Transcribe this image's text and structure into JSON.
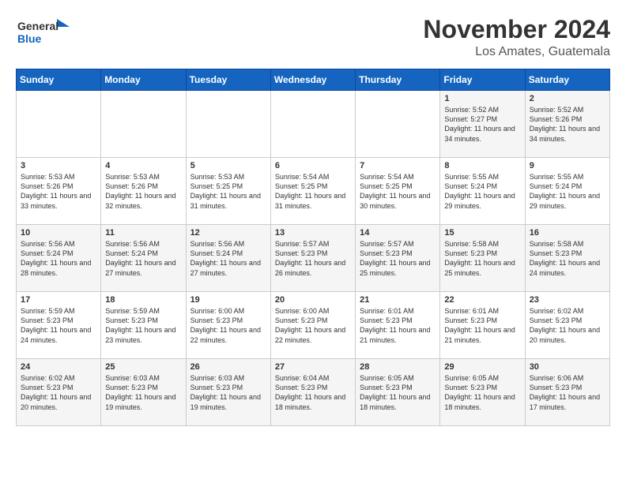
{
  "header": {
    "logo_general": "General",
    "logo_blue": "Blue",
    "month_title": "November 2024",
    "location": "Los Amates, Guatemala"
  },
  "days_of_week": [
    "Sunday",
    "Monday",
    "Tuesday",
    "Wednesday",
    "Thursday",
    "Friday",
    "Saturday"
  ],
  "weeks": [
    [
      {
        "day": "",
        "info": ""
      },
      {
        "day": "",
        "info": ""
      },
      {
        "day": "",
        "info": ""
      },
      {
        "day": "",
        "info": ""
      },
      {
        "day": "",
        "info": ""
      },
      {
        "day": "1",
        "info": "Sunrise: 5:52 AM\nSunset: 5:27 PM\nDaylight: 11 hours and 34 minutes."
      },
      {
        "day": "2",
        "info": "Sunrise: 5:52 AM\nSunset: 5:26 PM\nDaylight: 11 hours and 34 minutes."
      }
    ],
    [
      {
        "day": "3",
        "info": "Sunrise: 5:53 AM\nSunset: 5:26 PM\nDaylight: 11 hours and 33 minutes."
      },
      {
        "day": "4",
        "info": "Sunrise: 5:53 AM\nSunset: 5:26 PM\nDaylight: 11 hours and 32 minutes."
      },
      {
        "day": "5",
        "info": "Sunrise: 5:53 AM\nSunset: 5:25 PM\nDaylight: 11 hours and 31 minutes."
      },
      {
        "day": "6",
        "info": "Sunrise: 5:54 AM\nSunset: 5:25 PM\nDaylight: 11 hours and 31 minutes."
      },
      {
        "day": "7",
        "info": "Sunrise: 5:54 AM\nSunset: 5:25 PM\nDaylight: 11 hours and 30 minutes."
      },
      {
        "day": "8",
        "info": "Sunrise: 5:55 AM\nSunset: 5:24 PM\nDaylight: 11 hours and 29 minutes."
      },
      {
        "day": "9",
        "info": "Sunrise: 5:55 AM\nSunset: 5:24 PM\nDaylight: 11 hours and 29 minutes."
      }
    ],
    [
      {
        "day": "10",
        "info": "Sunrise: 5:56 AM\nSunset: 5:24 PM\nDaylight: 11 hours and 28 minutes."
      },
      {
        "day": "11",
        "info": "Sunrise: 5:56 AM\nSunset: 5:24 PM\nDaylight: 11 hours and 27 minutes."
      },
      {
        "day": "12",
        "info": "Sunrise: 5:56 AM\nSunset: 5:24 PM\nDaylight: 11 hours and 27 minutes."
      },
      {
        "day": "13",
        "info": "Sunrise: 5:57 AM\nSunset: 5:23 PM\nDaylight: 11 hours and 26 minutes."
      },
      {
        "day": "14",
        "info": "Sunrise: 5:57 AM\nSunset: 5:23 PM\nDaylight: 11 hours and 25 minutes."
      },
      {
        "day": "15",
        "info": "Sunrise: 5:58 AM\nSunset: 5:23 PM\nDaylight: 11 hours and 25 minutes."
      },
      {
        "day": "16",
        "info": "Sunrise: 5:58 AM\nSunset: 5:23 PM\nDaylight: 11 hours and 24 minutes."
      }
    ],
    [
      {
        "day": "17",
        "info": "Sunrise: 5:59 AM\nSunset: 5:23 PM\nDaylight: 11 hours and 24 minutes."
      },
      {
        "day": "18",
        "info": "Sunrise: 5:59 AM\nSunset: 5:23 PM\nDaylight: 11 hours and 23 minutes."
      },
      {
        "day": "19",
        "info": "Sunrise: 6:00 AM\nSunset: 5:23 PM\nDaylight: 11 hours and 22 minutes."
      },
      {
        "day": "20",
        "info": "Sunrise: 6:00 AM\nSunset: 5:23 PM\nDaylight: 11 hours and 22 minutes."
      },
      {
        "day": "21",
        "info": "Sunrise: 6:01 AM\nSunset: 5:23 PM\nDaylight: 11 hours and 21 minutes."
      },
      {
        "day": "22",
        "info": "Sunrise: 6:01 AM\nSunset: 5:23 PM\nDaylight: 11 hours and 21 minutes."
      },
      {
        "day": "23",
        "info": "Sunrise: 6:02 AM\nSunset: 5:23 PM\nDaylight: 11 hours and 20 minutes."
      }
    ],
    [
      {
        "day": "24",
        "info": "Sunrise: 6:02 AM\nSunset: 5:23 PM\nDaylight: 11 hours and 20 minutes."
      },
      {
        "day": "25",
        "info": "Sunrise: 6:03 AM\nSunset: 5:23 PM\nDaylight: 11 hours and 19 minutes."
      },
      {
        "day": "26",
        "info": "Sunrise: 6:03 AM\nSunset: 5:23 PM\nDaylight: 11 hours and 19 minutes."
      },
      {
        "day": "27",
        "info": "Sunrise: 6:04 AM\nSunset: 5:23 PM\nDaylight: 11 hours and 18 minutes."
      },
      {
        "day": "28",
        "info": "Sunrise: 6:05 AM\nSunset: 5:23 PM\nDaylight: 11 hours and 18 minutes."
      },
      {
        "day": "29",
        "info": "Sunrise: 6:05 AM\nSunset: 5:23 PM\nDaylight: 11 hours and 18 minutes."
      },
      {
        "day": "30",
        "info": "Sunrise: 6:06 AM\nSunset: 5:23 PM\nDaylight: 11 hours and 17 minutes."
      }
    ]
  ]
}
